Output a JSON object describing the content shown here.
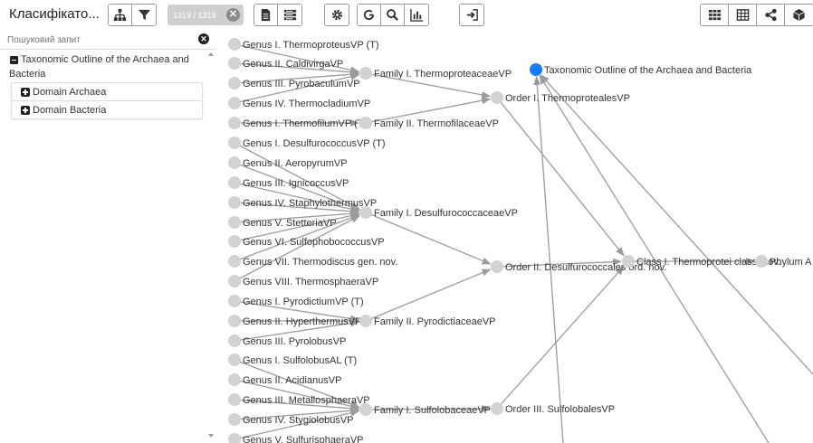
{
  "app": {
    "title": "Класифікато..."
  },
  "toolbar": {
    "counter_text": "1319 / 1319",
    "clear_glyph": "✕",
    "left_icons": [
      "hierarchy-icon",
      "filter-icon"
    ],
    "mid_icons": [
      "document-icon",
      "list-icon",
      "settings-icon",
      "google-icon",
      "search-icon",
      "chart-icon",
      "export-icon"
    ],
    "right_icons": [
      "grid-view-icon",
      "table-view-icon",
      "graph-view-icon",
      "cube-icon"
    ],
    "accent_color": "#2f7dff"
  },
  "sidebar": {
    "search_placeholder": "Пошуковий запит",
    "clear_glyph": "✕",
    "tree": {
      "root_label": "Taxonomic Outline of the Archaea and Bacteria",
      "children": [
        "Domain Archaea",
        "Domain Bacteria"
      ]
    }
  },
  "graph": {
    "node_color": "#d2d2d2",
    "highlight_color": "#1a7bff",
    "edge_color": "#9b9b9b",
    "nodes": [
      {
        "id": "g1",
        "label": "Genus I. ThermoproteusVP (T)"
      },
      {
        "id": "g2",
        "label": "Genus II. CaldivirgaVP"
      },
      {
        "id": "g3",
        "label": "Genus III. PyrobaculumVP"
      },
      {
        "id": "g4",
        "label": "Genus IV. ThermocladiumVP"
      },
      {
        "id": "g5",
        "label": "Genus I. ThermofilumVP (T)"
      },
      {
        "id": "g6",
        "label": "Genus I. DesulfurococcusVP (T)"
      },
      {
        "id": "g7",
        "label": "Genus II. AeropyrumVP"
      },
      {
        "id": "g8",
        "label": "Genus III. IgnicoccusVP"
      },
      {
        "id": "g9",
        "label": "Genus IV. StaphylothermusVP"
      },
      {
        "id": "g10",
        "label": "Genus V. StetteriaVP"
      },
      {
        "id": "g11",
        "label": "Genus VI. SulfophobococcusVP"
      },
      {
        "id": "g12",
        "label": "Genus VII. Thermodiscus gen. nov."
      },
      {
        "id": "g13",
        "label": "Genus VIII. ThermosphaeraVP"
      },
      {
        "id": "g14",
        "label": "Genus I. PyrodictiumVP (T)"
      },
      {
        "id": "g15",
        "label": "Genus II. HyperthermusVP"
      },
      {
        "id": "g16",
        "label": "Genus III. PyrolobusVP"
      },
      {
        "id": "g17",
        "label": "Genus I. SulfolobusAL (T)"
      },
      {
        "id": "g18",
        "label": "Genus II. AcidianusVP"
      },
      {
        "id": "g19",
        "label": "Genus III. MetallosphaeraVP"
      },
      {
        "id": "g20",
        "label": "Genus IV. StygiolobusVP"
      },
      {
        "id": "g21",
        "label": "Genus V. SulfurisphaeraVP"
      },
      {
        "id": "f1",
        "label": "Family I. ThermoproteaceaeVP"
      },
      {
        "id": "f2",
        "label": "Family II. ThermofilaceaeVP"
      },
      {
        "id": "f3",
        "label": "Family I. DesulfurococcaceaeVP"
      },
      {
        "id": "f4",
        "label": "Family II. PyrodictiaceaeVP"
      },
      {
        "id": "f5",
        "label": "Family I. SulfolobaceaeVP"
      },
      {
        "id": "o1",
        "label": "Order I. ThermoprotealesVP"
      },
      {
        "id": "o2",
        "label": "Order II. Desulfurococcales ord. nov."
      },
      {
        "id": "o3",
        "label": "Order III. SulfolobalesVP"
      },
      {
        "id": "c1",
        "label": "Class I. Thermoprotei class. nov."
      },
      {
        "id": "p1",
        "label": "Phylum A"
      },
      {
        "id": "root",
        "label": "Taxonomic Outline of the Archaea and Bacteria",
        "highlight": true
      }
    ],
    "edges": [
      [
        "g1",
        "f1"
      ],
      [
        "g2",
        "f1"
      ],
      [
        "g3",
        "f1"
      ],
      [
        "g4",
        "f1"
      ],
      [
        "g5",
        "f2"
      ],
      [
        "g6",
        "f3"
      ],
      [
        "g7",
        "f3"
      ],
      [
        "g8",
        "f3"
      ],
      [
        "g9",
        "f3"
      ],
      [
        "g10",
        "f3"
      ],
      [
        "g11",
        "f3"
      ],
      [
        "g12",
        "f3"
      ],
      [
        "g13",
        "f3"
      ],
      [
        "g14",
        "f4"
      ],
      [
        "g15",
        "f4"
      ],
      [
        "g16",
        "f4"
      ],
      [
        "g17",
        "f5"
      ],
      [
        "g18",
        "f5"
      ],
      [
        "g19",
        "f5"
      ],
      [
        "g20",
        "f5"
      ],
      [
        "g21",
        "f5"
      ],
      [
        "f1",
        "o1"
      ],
      [
        "f2",
        "o1"
      ],
      [
        "f3",
        "o2"
      ],
      [
        "f4",
        "o2"
      ],
      [
        "f5",
        "o3"
      ],
      [
        "o1",
        "c1"
      ],
      [
        "o2",
        "c1"
      ],
      [
        "o3",
        "c1"
      ],
      [
        "c1",
        "p1"
      ]
    ]
  }
}
